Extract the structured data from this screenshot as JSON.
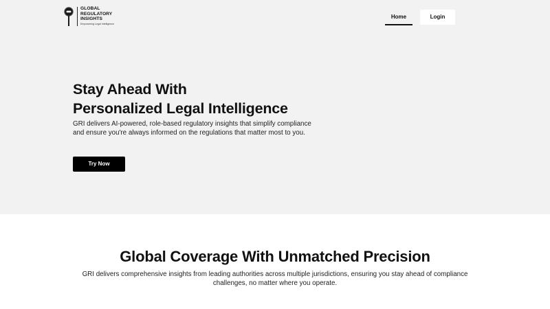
{
  "header": {
    "logo": {
      "line1": "GLOBAL",
      "line2": "REGULATORY",
      "line3": "INSIGHTS",
      "tagline": "Empowering Legal Intelligence"
    },
    "nav": {
      "home_label": "Home",
      "login_label": "Login"
    }
  },
  "hero": {
    "title_line1": "Stay Ahead With",
    "title_line2": "Personalized Legal Intelligence",
    "description": "GRI delivers AI-powered, role-based regulatory insights that simplify compliance and ensure you're always informed on the regulations that matter most to you.",
    "cta_label": "Try Now"
  },
  "coverage": {
    "title": "Global Coverage With Unmatched Precision",
    "description": "GRI delivers comprehensive insights from leading authorities across multiple jurisdictions, ensuring you stay ahead of compliance challenges, no matter where you operate."
  },
  "colors": {
    "hero_background": "#f2f2f2",
    "page_background": "#ffffff",
    "primary_button": "#000000",
    "text": "#111111"
  }
}
